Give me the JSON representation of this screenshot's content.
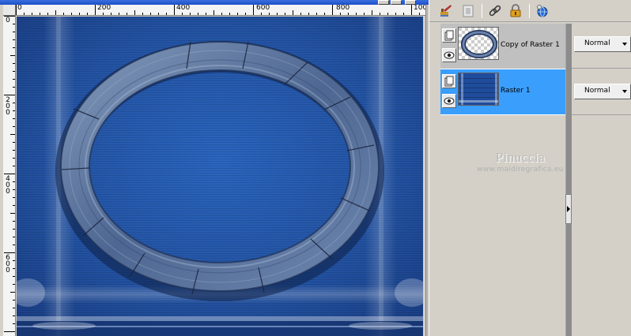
{
  "ruler": {
    "top_labels": [
      "0",
      "200",
      "400",
      "600",
      "800",
      "100"
    ],
    "left_labels": [
      "0",
      "200",
      "400",
      "600"
    ]
  },
  "toolbar": {
    "icons": [
      "brush-icon",
      "mask-icon",
      "link-icon",
      "lock-icon",
      "globe-icon"
    ]
  },
  "layers": [
    {
      "name": "Copy of Raster 1",
      "blend_mode": "Normal",
      "state": "selected"
    },
    {
      "name": "Raster 1",
      "blend_mode": "Normal",
      "state": "active"
    }
  ],
  "watermark": {
    "name": "Pinuccia",
    "site": "www.maidiregrafica.eu"
  },
  "colors": {
    "canvas_blue": "#2457a8",
    "active_layer": "#3a9efc",
    "selected_layer": "#c0c0c0",
    "title_bar": "#1b4fc8"
  }
}
